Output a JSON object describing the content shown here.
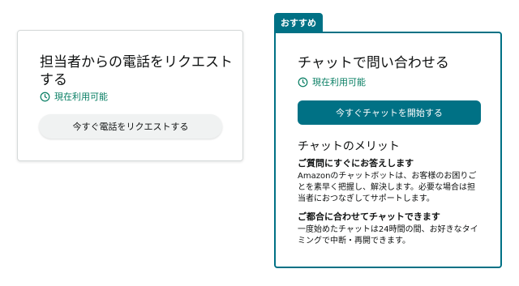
{
  "phone_card": {
    "title": "担当者からの電話をリクエストする",
    "availability": "現在利用可能",
    "button_label": "今すぐ電話をリクエストする"
  },
  "chat_card": {
    "badge": "おすすめ",
    "title": "チャットで問い合わせる",
    "availability": "現在利用可能",
    "button_label": "今すぐチャットを開始する",
    "merits_title": "チャットのメリット",
    "features": [
      {
        "title": "ご質問にすぐにお答えします",
        "desc": "Amazonのチャットボットは、お客様のお困りごとを素早く把握し、解決します。必要な場合は担当者におつなぎしてサポートします。"
      },
      {
        "title": "ご都合に合わせてチャットできます",
        "desc": "一度始めたチャットは24時間の間、お好きなタイミングで中断・再開できます。"
      }
    ]
  },
  "colors": {
    "accent": "#007185",
    "available_green": "#067d62"
  },
  "icons": {
    "availability": "clock-icon"
  }
}
